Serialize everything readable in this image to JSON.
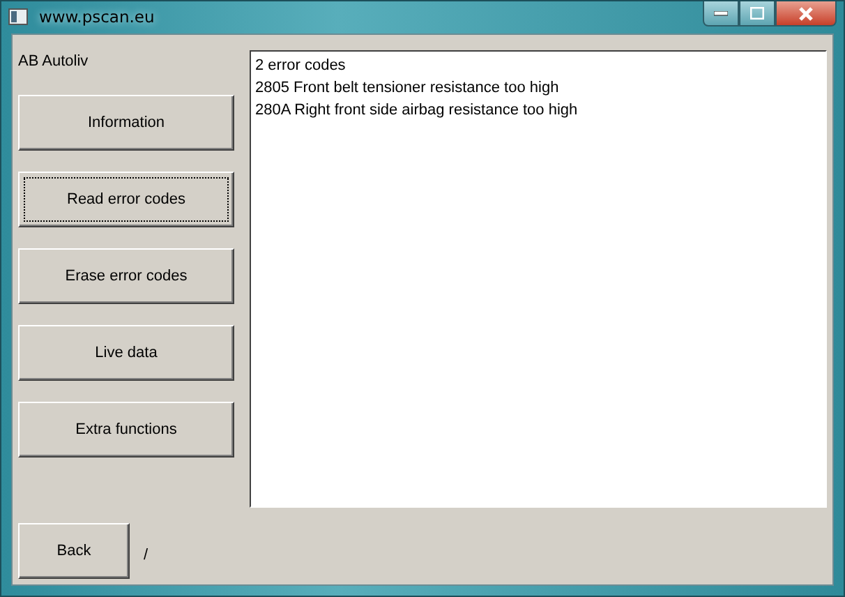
{
  "window": {
    "title": "www.pscan.eu"
  },
  "module_label": "AB Autoliv",
  "buttons": [
    {
      "label": "Information",
      "focused": false
    },
    {
      "label": "Read error codes",
      "focused": true
    },
    {
      "label": "Erase error codes",
      "focused": false
    },
    {
      "label": "Live data",
      "focused": false
    },
    {
      "label": "Extra functions",
      "focused": false
    }
  ],
  "output_lines": [
    "2 error codes",
    "2805 Front belt tensioner resistance too high",
    "280A Right front side airbag resistance too high"
  ],
  "back_button": {
    "label": "Back",
    "focused": false
  },
  "status_text": "/"
}
